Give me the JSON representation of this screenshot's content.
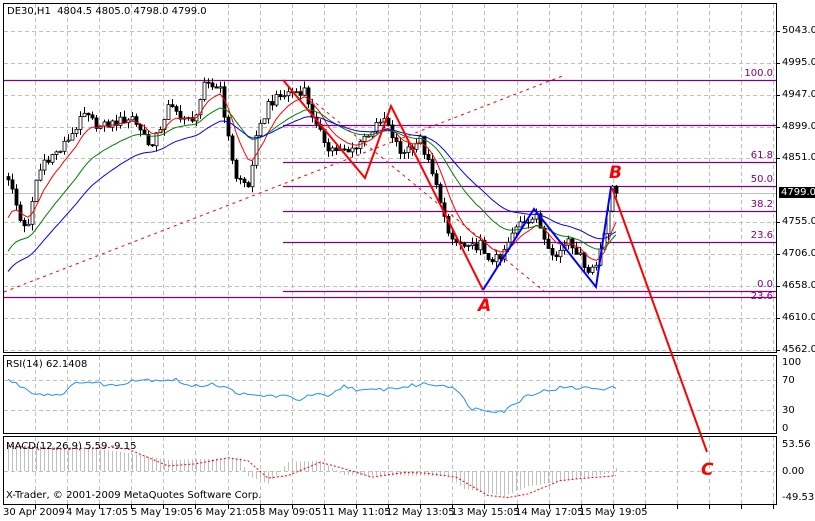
{
  "header": {
    "symbol": "DE30,H1",
    "ohlc": "4804.5 4805.0 4798.0 4799.0"
  },
  "price_axis": {
    "labels": [
      "5043.0",
      "4995.0",
      "4947.0",
      "4899.0",
      "4851.0",
      "4755.0",
      "4706.0",
      "4658.0",
      "4610.0",
      "4562.0"
    ],
    "current": "4799.0"
  },
  "fibonacci": {
    "levels": [
      {
        "label": "100.0",
        "price": 4969
      },
      {
        "label": "",
        "price": 4901
      },
      {
        "label": "61.8",
        "price": 4846
      },
      {
        "label": "50.0",
        "price": 4810
      },
      {
        "label": "38.2",
        "price": 4772
      },
      {
        "label": "23.6",
        "price": 4725
      },
      {
        "label": "0.0",
        "price": 4651
      },
      {
        "label": "23.6",
        "price": 4642
      }
    ]
  },
  "waves": {
    "a": "A",
    "b": "B",
    "c": "C"
  },
  "rsi": {
    "title": "RSI(14) 62.1408",
    "labels": [
      "100",
      "70",
      "30",
      "0"
    ]
  },
  "macd": {
    "title": "MACD(12,26,9) 5.59 -9.15",
    "labels": [
      "53.56",
      "0.00",
      "-49.53"
    ]
  },
  "copyright": "X-Trader, © 2001-2009 MetaQuotes Software Corp.",
  "time_axis": [
    "30 Apr 2009",
    "4 May 17:05",
    "5 May 19:05",
    "6 May 21:05",
    "8 May 09:05",
    "11 May 11:05",
    "12 May 13:05",
    "13 May 15:05",
    "14 May 17:05",
    "15 May 19:05"
  ],
  "colors": {
    "fib": "#800080",
    "ma_fast": "#ff0000",
    "ma_mid": "#008000",
    "ma_slow": "#0000ff",
    "rsi": "#1e90ff",
    "zigzag_red": "#ff0000",
    "zigzag_blue": "#0000ff"
  },
  "chart_data": {
    "type": "candlestick",
    "symbol": "DE30",
    "timeframe": "H1",
    "ylim": [
      4562,
      5043
    ],
    "bars": 153,
    "close_path": [
      [
        0,
        4823
      ],
      [
        3,
        4758
      ],
      [
        5,
        4747
      ],
      [
        7,
        4818
      ],
      [
        9,
        4848
      ],
      [
        13,
        4863
      ],
      [
        19,
        4916
      ],
      [
        23,
        4898
      ],
      [
        31,
        4913
      ],
      [
        36,
        4868
      ],
      [
        40,
        4928
      ],
      [
        46,
        4904
      ],
      [
        49,
        4959
      ],
      [
        53,
        4959
      ],
      [
        55,
        4879
      ],
      [
        57,
        4823
      ],
      [
        60,
        4808
      ],
      [
        62,
        4879
      ],
      [
        65,
        4934
      ],
      [
        70,
        4950
      ],
      [
        74,
        4954
      ],
      [
        77,
        4898
      ],
      [
        80,
        4868
      ],
      [
        85,
        4859
      ],
      [
        90,
        4889
      ],
      [
        94,
        4909
      ],
      [
        98,
        4859
      ],
      [
        103,
        4879
      ],
      [
        108,
        4790
      ],
      [
        110,
        4732
      ],
      [
        115,
        4713
      ],
      [
        118,
        4723
      ],
      [
        119,
        4702
      ],
      [
        123,
        4698
      ],
      [
        125,
        4723
      ],
      [
        128,
        4758
      ],
      [
        132,
        4762
      ],
      [
        134,
        4732
      ],
      [
        137,
        4702
      ],
      [
        140,
        4732
      ],
      [
        143,
        4702
      ],
      [
        145,
        4683
      ],
      [
        147,
        4690
      ],
      [
        149,
        4743
      ],
      [
        151,
        4803
      ],
      [
        152,
        4799
      ]
    ],
    "ma_start": {
      "fast": 4745,
      "mid": 4700,
      "slow": 4672
    },
    "ma_periods": {
      "fast": 8,
      "mid": 21,
      "slow": 34
    },
    "rsi_path": [
      [
        0,
        75
      ],
      [
        7,
        54
      ],
      [
        13,
        53
      ],
      [
        18,
        73
      ],
      [
        27,
        66
      ],
      [
        31,
        75
      ],
      [
        42,
        75
      ],
      [
        46,
        64
      ],
      [
        51,
        70
      ],
      [
        56,
        59
      ],
      [
        60,
        51
      ],
      [
        68,
        51
      ],
      [
        73,
        46
      ],
      [
        77,
        54
      ],
      [
        80,
        48
      ],
      [
        84,
        66
      ],
      [
        89,
        58
      ],
      [
        99,
        64
      ],
      [
        104,
        69
      ],
      [
        111,
        66
      ],
      [
        116,
        32
      ],
      [
        124,
        28
      ],
      [
        130,
        53
      ],
      [
        138,
        63
      ],
      [
        152,
        62.14
      ]
    ],
    "macd_signal": [
      [
        0,
        49
      ],
      [
        12,
        43
      ],
      [
        26,
        46
      ],
      [
        30,
        43
      ],
      [
        40,
        10
      ],
      [
        47,
        14
      ],
      [
        55,
        26
      ],
      [
        60,
        20
      ],
      [
        65,
        -14
      ],
      [
        70,
        -9
      ],
      [
        78,
        17
      ],
      [
        83,
        7
      ],
      [
        91,
        -12
      ],
      [
        99,
        -3
      ],
      [
        104,
        -4
      ],
      [
        112,
        -12
      ],
      [
        120,
        -48
      ],
      [
        125,
        -52
      ],
      [
        130,
        -45
      ],
      [
        138,
        -19
      ],
      [
        143,
        -15
      ],
      [
        152,
        -9.15
      ]
    ],
    "macd_hist": [
      [
        0,
        50
      ],
      [
        20,
        46
      ],
      [
        30,
        35
      ],
      [
        40,
        22
      ],
      [
        58,
        25
      ],
      [
        60,
        -10
      ],
      [
        65,
        -25
      ],
      [
        70,
        18
      ],
      [
        78,
        20
      ],
      [
        84,
        -8
      ],
      [
        110,
        -10
      ],
      [
        114,
        -35
      ],
      [
        124,
        -50
      ],
      [
        130,
        -30
      ],
      [
        145,
        -12
      ],
      [
        151,
        -3
      ],
      [
        152,
        5.59
      ]
    ]
  }
}
